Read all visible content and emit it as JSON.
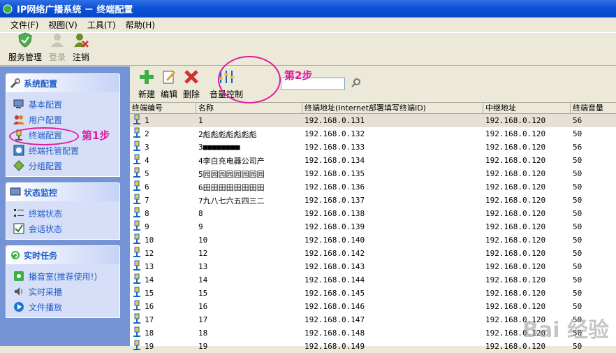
{
  "window": {
    "title": "IP网络广播系统  －  终端配置"
  },
  "menu": [
    "文件(F)",
    "视图(V)",
    "工具(T)",
    "帮助(H)"
  ],
  "toolbar": {
    "service": "服务管理",
    "login": "登录",
    "logout": "注销"
  },
  "sidebar": {
    "panels": [
      {
        "title": "系统配置",
        "items": [
          "基本配置",
          "用户配置",
          "终端配置",
          "终端托管配置",
          "分组配置"
        ]
      },
      {
        "title": "状态监控",
        "items": [
          "终端状态",
          "会话状态"
        ]
      },
      {
        "title": "实时任务",
        "items": [
          "播音室(推荐使用!)",
          "实时采播",
          "文件播放"
        ]
      }
    ]
  },
  "subtoolbar": {
    "new": "新建",
    "edit": "编辑",
    "delete": "删除",
    "volume": "音量控制"
  },
  "annotations": {
    "step1": "第1步",
    "step2": "第2步"
  },
  "table": {
    "headers": [
      "终端编号",
      "名称",
      "终端地址(Internet部署填写终端ID)",
      "中继地址",
      "终端音量"
    ],
    "rows": [
      [
        "1",
        "1",
        "192.168.0.131",
        "192.168.0.120",
        "56"
      ],
      [
        "2",
        "2彪彪彪彪彪彪彪",
        "192.168.0.132",
        "192.168.0.120",
        "50"
      ],
      [
        "3",
        "3■■■■■■■■",
        "192.168.0.133",
        "192.168.0.120",
        "56"
      ],
      [
        "4",
        "4李白充电器公司产",
        "192.168.0.134",
        "192.168.0.120",
        "50"
      ],
      [
        "5",
        "5园园园园园园园园",
        "192.168.0.135",
        "192.168.0.120",
        "50"
      ],
      [
        "6",
        "6田田田田田田田田",
        "192.168.0.136",
        "192.168.0.120",
        "50"
      ],
      [
        "7",
        "7九八七六五四三二",
        "192.168.0.137",
        "192.168.0.120",
        "50"
      ],
      [
        "8",
        "8",
        "192.168.0.138",
        "192.168.0.120",
        "50"
      ],
      [
        "9",
        "9",
        "192.168.0.139",
        "192.168.0.120",
        "50"
      ],
      [
        "10",
        "10",
        "192.168.0.140",
        "192.168.0.120",
        "50"
      ],
      [
        "12",
        "12",
        "192.168.0.142",
        "192.168.0.120",
        "50"
      ],
      [
        "13",
        "13",
        "192.168.0.143",
        "192.168.0.120",
        "50"
      ],
      [
        "14",
        "14",
        "192.168.0.144",
        "192.168.0.120",
        "50"
      ],
      [
        "15",
        "15",
        "192.168.0.145",
        "192.168.0.120",
        "50"
      ],
      [
        "16",
        "16",
        "192.168.0.146",
        "192.168.0.120",
        "50"
      ],
      [
        "17",
        "17",
        "192.168.0.147",
        "192.168.0.120",
        "50"
      ],
      [
        "18",
        "18",
        "192.168.0.148",
        "192.168.0.120",
        "50"
      ],
      [
        "19",
        "19",
        "192.168.0.149",
        "192.168.0.120",
        "50"
      ]
    ]
  },
  "watermark": "Bai 经验"
}
